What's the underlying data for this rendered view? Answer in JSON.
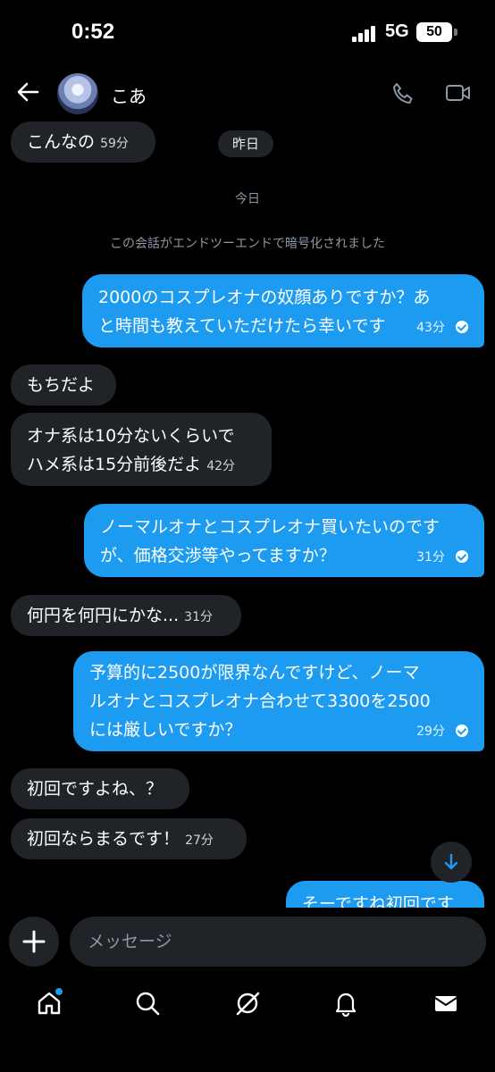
{
  "status": {
    "time": "0:52",
    "network": "5G",
    "battery": "50"
  },
  "header": {
    "contact_name": "こあ"
  },
  "chat": {
    "yesterday_label": "昨日",
    "today_label": "今日",
    "encryption_notice": "この会話がエンドツーエンドで暗号化されました",
    "messages": [
      {
        "dir": "in",
        "lines": [
          "こんなの"
        ],
        "time": "59分"
      },
      {
        "dir": "out",
        "lines": [
          "2000のコスプレオナの奴顔ありですか？あ",
          "と時間も教えていただけたら幸いです"
        ],
        "time": "43分"
      },
      {
        "dir": "in",
        "lines": [
          "もちだよ"
        ],
        "time": ""
      },
      {
        "dir": "in",
        "lines": [
          "オナ系は10分ないくらいで",
          "ハメ系は15分前後だよ"
        ],
        "time": "42分"
      },
      {
        "dir": "out",
        "lines": [
          "ノーマルオナとコスプレオナ買いたいのです",
          "が、価格交渉等やってますか？"
        ],
        "time": "31分"
      },
      {
        "dir": "in",
        "lines": [
          "何円を何円にかな..."
        ],
        "time": "31分"
      },
      {
        "dir": "out",
        "lines": [
          "予算的に2500が限界なんですけど、ノーマ",
          "ルオナとコスプレオナ合わせて3300を2500",
          "には厳しいですか？"
        ],
        "time": "29分"
      },
      {
        "dir": "in",
        "lines": [
          "初回ですよね、？"
        ],
        "time": ""
      },
      {
        "dir": "in",
        "lines": [
          "初回ならまるです！"
        ],
        "time": "27分"
      },
      {
        "dir": "out",
        "lines": [
          "そーですね初回です"
        ],
        "time": ""
      }
    ]
  },
  "composer": {
    "placeholder": "メッセージ"
  },
  "nav": [
    "home-icon",
    "search-icon",
    "grok-icon",
    "bell-icon",
    "mail-icon"
  ],
  "colors": {
    "accent": "#1d9bf0",
    "bubble_in": "#202327",
    "background": "#000000"
  }
}
